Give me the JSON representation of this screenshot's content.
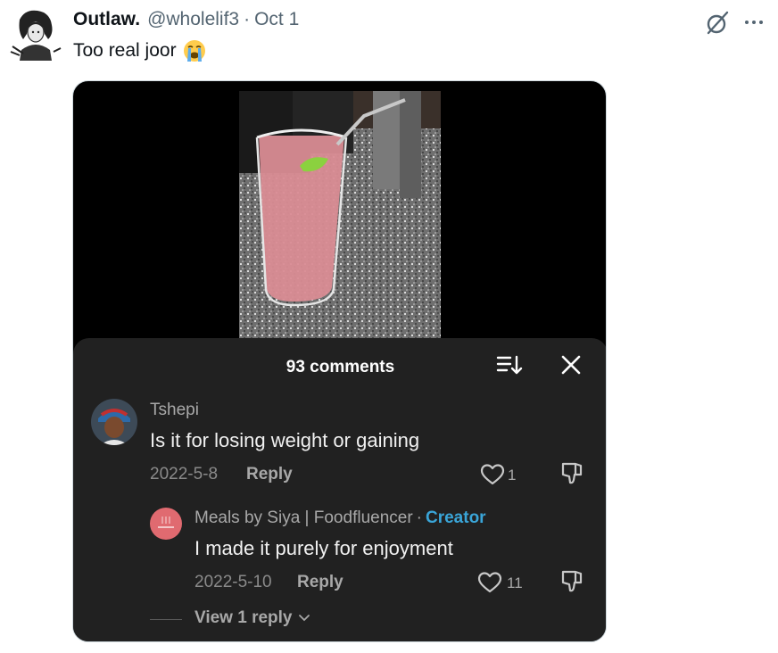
{
  "tweet": {
    "author_name": "Outlaw.",
    "author_handle": "@wholelif3",
    "separator": "·",
    "date": "Oct 1",
    "text": "Too real joor",
    "emoji": "loudly-crying-face"
  },
  "comments_panel": {
    "title": "93 comments",
    "comments": [
      {
        "author": "Tshepi",
        "text": "Is it for losing weight or gaining",
        "date": "2022-5-8",
        "reply_label": "Reply",
        "likes": "1"
      }
    ],
    "replies": [
      {
        "author": "Meals by Siya | Foodfluencer",
        "separator": "·",
        "badge": "Creator",
        "text": "I made it purely for enjoyment",
        "date": "2022-5-10",
        "reply_label": "Reply",
        "likes": "11"
      }
    ],
    "view_replies_label": "View 1 reply"
  },
  "colors": {
    "panel_bg": "#212121",
    "creator_badge": "#3aa5d8",
    "handle_gray": "#536471"
  }
}
